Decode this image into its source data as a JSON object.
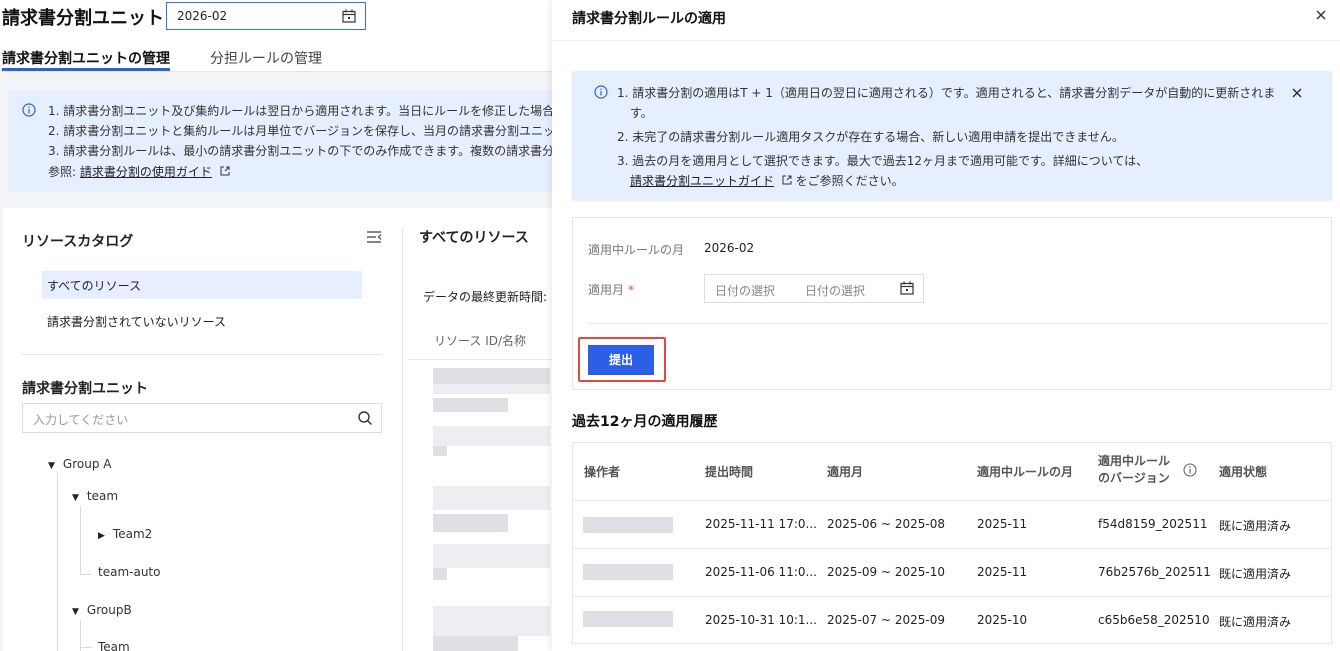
{
  "app": {
    "title": "請求書分割ユニット",
    "month": "2026-02"
  },
  "tabs": [
    {
      "label": "請求書分割ユニットの管理"
    },
    {
      "label": "分担ルールの管理"
    }
  ],
  "notice": {
    "lines": [
      "1. 請求書分割ユニット及び集約ルールは翌日から適用されます。当日にルールを修正した場合",
      "2. 請求書分割ユニットと集約ルールは月単位でバージョンを保存し、当月の請求書分割ユニッ",
      "3. 請求書分割ルールは、最小の請求書分割ユニットの下でのみ作成できます。複数の請求書分"
    ],
    "ref_prefix": "参照:",
    "ref_link": "請求書分割の使用ガイド"
  },
  "catalog": {
    "title": "リソースカタログ",
    "items": [
      "すべてのリソース",
      "請求書分割されていないリソース"
    ],
    "units_title": "請求書分割ユニット",
    "search_placeholder": "入力してください",
    "tree": [
      "Group A",
      "team",
      "Team2",
      "team-auto",
      "GroupB",
      "Team"
    ]
  },
  "resources": {
    "title": "すべてのリソース",
    "updated_label": "データの最終更新時間:",
    "column": "リソース ID/名称"
  },
  "drawer": {
    "title": "請求書分割ルールの適用",
    "notice": {
      "line1": "1. 請求書分割の適用はT + 1（適用日の翌日に適用される）です。適用されると、請求書分割データが自動的に更新されま",
      "line1b": "す。",
      "line2": "2. 未完了の請求書分割ルール適用タスクが存在する場合、新しい適用申請を提出できません。",
      "line3": "3. 過去の月を適用月として選択できます。最大で過去12ヶ月まで適用可能です。詳細については、",
      "link": "請求書分割ユニットガイド",
      "suffix": "をご参照ください。"
    },
    "form": {
      "current_rule_month_label": "適用中ルールの月",
      "current_rule_month_value": "2026-02",
      "apply_month_label": "適用月",
      "start_placeholder": "日付の選択",
      "end_placeholder": "日付の選択",
      "submit_label": "提出"
    },
    "history": {
      "title": "過去12ヶ月の適用履歴",
      "columns": {
        "operator": "操作者",
        "submit_time": "提出時間",
        "apply_month": "適用月",
        "rule_month": "適用中ルールの月",
        "rule_version": "適用中ルール\nのバージョン",
        "status": "適用状態"
      },
      "rows": [
        {
          "submit_time": "2025-11-11 17:0...",
          "apply_month": "2025-06 ~ 2025-08",
          "rule_month": "2025-11",
          "version": "f54d8159_202511",
          "status": "既に適用済み"
        },
        {
          "submit_time": "2025-11-06 11:0...",
          "apply_month": "2025-09 ~ 2025-10",
          "rule_month": "2025-11",
          "version": "76b2576b_202511",
          "status": "既に適用済み"
        },
        {
          "submit_time": "2025-10-31 10:1...",
          "apply_month": "2025-07 ~ 2025-09",
          "rule_month": "2025-10",
          "version": "c65b6e58_202510",
          "status": "既に適用済み"
        }
      ]
    }
  },
  "colors": {
    "primary": "#2c5fe6",
    "notice_bg": "#e6efff",
    "highlight_border": "#e5483f"
  }
}
